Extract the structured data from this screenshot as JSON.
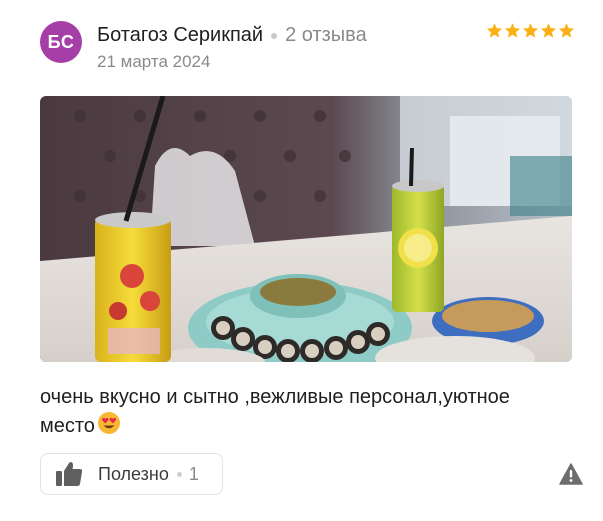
{
  "review": {
    "avatar_initials": "БС",
    "avatar_color": "#a63ea8",
    "author": "Ботагоз Серикпай",
    "reviews_count": "2 отзыва",
    "date": "21 марта 2024",
    "rating": 5,
    "star_color": "#fbb116",
    "text": "очень вкусно и сытно ,вежливые персонал,уютное место",
    "text_emoji": "smiling-face-with-heart-eyes-icon",
    "photo": "photo of sushi roll plate with sauce bowl and two canned drinks on a table"
  },
  "actions": {
    "helpful_label": "Полезно",
    "helpful_count": "1",
    "helpful_icon": "thumbs-up-icon",
    "report_icon": "warning-icon"
  }
}
